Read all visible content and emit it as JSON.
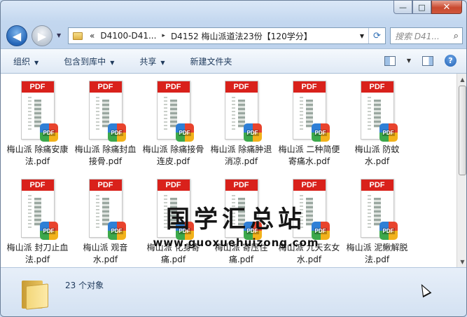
{
  "window": {
    "min_glyph": "—",
    "max_glyph": "□",
    "close_glyph": "✕"
  },
  "nav": {
    "back_glyph": "◀",
    "fwd_glyph": "▶",
    "dropdown_glyph": "▼"
  },
  "address": {
    "overflow": "«",
    "crumbs": [
      "D4100-D41...",
      "D4152 梅山派道法23份【120学分】"
    ],
    "separator": "▸",
    "refresh_glyph": "⟳"
  },
  "search": {
    "placeholder": "搜索 D41...",
    "icon": "search-icon"
  },
  "toolbar": {
    "organize": "组织",
    "include_library": "包含到库中",
    "share": "共享",
    "new_folder": "新建文件夹",
    "dropdown_glyph": "▼",
    "help_glyph": "?"
  },
  "files": [
    {
      "name": "梅山派 除痛安康法.pdf"
    },
    {
      "name": "梅山派 除痛封血接骨.pdf"
    },
    {
      "name": "梅山派 除痛接骨连皮.pdf"
    },
    {
      "name": "梅山派 除痛肿退消凉.pdf"
    },
    {
      "name": "梅山派 二种简便寄痛水.pdf"
    },
    {
      "name": "梅山派 防蚊水.pdf"
    },
    {
      "name": "梅山派 封刀止血法.pdf"
    },
    {
      "name": "梅山派 观音水.pdf"
    },
    {
      "name": "梅山派 化身寄痛.pdf"
    },
    {
      "name": "梅山派 寄压住痛.pdf"
    },
    {
      "name": "梅山派 九天玄女水.pdf"
    },
    {
      "name": "梅山派 泥鳅解脱法.pdf"
    }
  ],
  "thumb": {
    "header": "PDF",
    "badge": "PDF"
  },
  "watermark": {
    "title": "国学汇总站",
    "url": "www.guoxuehuizong.com"
  },
  "status": {
    "count": "23 个对象"
  },
  "scroll": {
    "up_glyph": "▲",
    "down_glyph": "▼"
  },
  "colors": {
    "pdf_red": "#d9211b",
    "toolbar_text": "#1e395b",
    "close_red": "#c9492f"
  }
}
